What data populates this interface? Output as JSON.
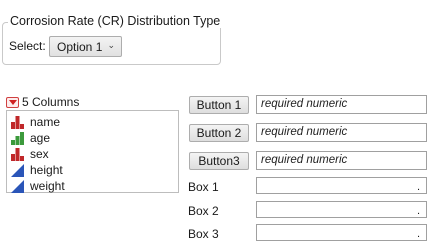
{
  "group": {
    "title": "Corrosion Rate (CR) Distribution Type",
    "select_label": "Select:",
    "select_value": "Option 1"
  },
  "columns": {
    "header": "5 Columns",
    "items": [
      {
        "label": "name",
        "icon": "nominal-icon",
        "color": "#c0282a"
      },
      {
        "label": "age",
        "icon": "ordinal-icon",
        "color": "#3c9a3c"
      },
      {
        "label": "sex",
        "icon": "nominal-icon",
        "color": "#c0282a"
      },
      {
        "label": "height",
        "icon": "continuous-icon",
        "color": "#2a55b8"
      },
      {
        "label": "weight",
        "icon": "continuous-icon",
        "color": "#2a55b8"
      }
    ]
  },
  "role_buttons": [
    {
      "label": "Button 1",
      "placeholder": "required numeric"
    },
    {
      "label": "Button 2",
      "placeholder": "required numeric"
    },
    {
      "label": "Button3",
      "placeholder": "required numeric"
    }
  ],
  "boxes": [
    {
      "label": "Box 1",
      "value": "."
    },
    {
      "label": "Box 2",
      "value": "."
    },
    {
      "label": "Box 3",
      "value": "."
    }
  ]
}
